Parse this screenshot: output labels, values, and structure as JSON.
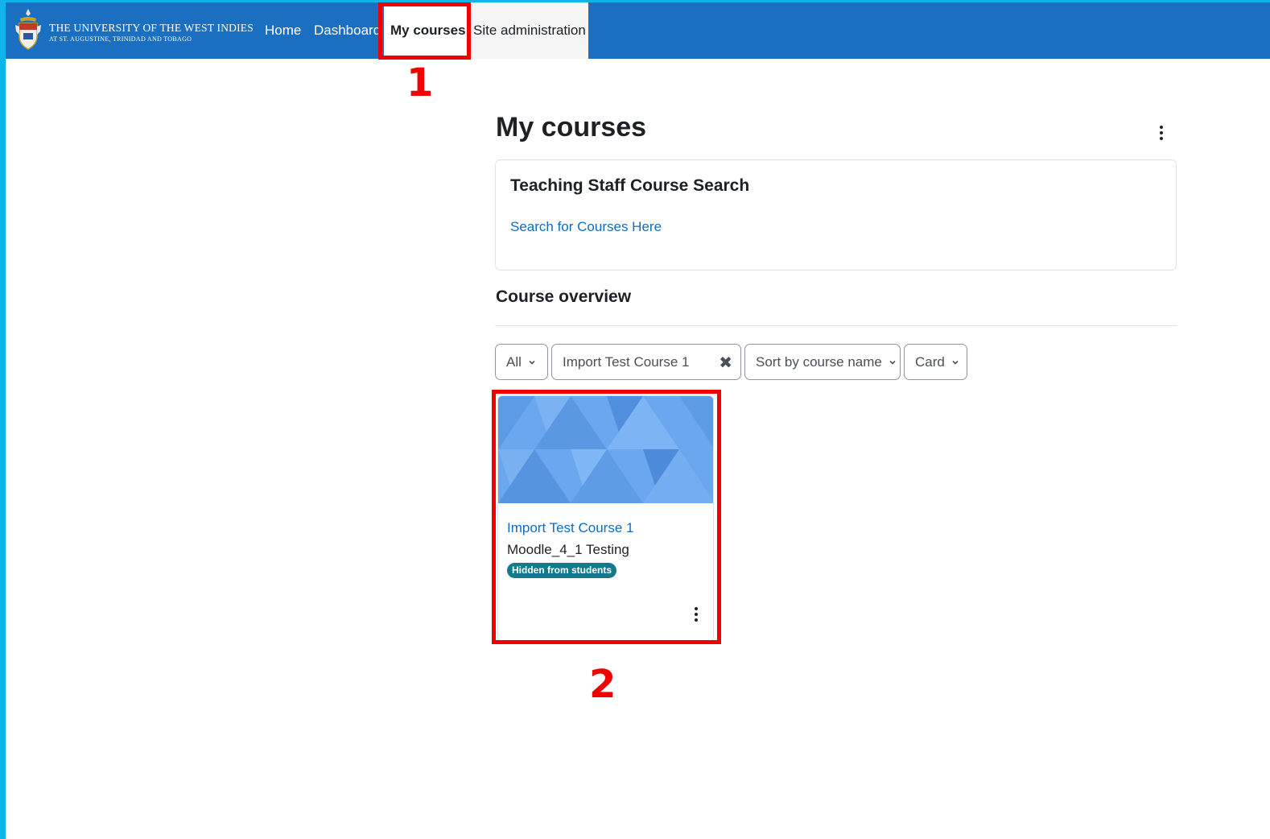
{
  "navbar": {
    "logo_line1": "THE UNIVERSITY OF THE WEST INDIES",
    "logo_line2": "AT ST. AUGUSTINE, TRINIDAD AND TOBAGO",
    "items": [
      {
        "label": "Home"
      },
      {
        "label": "Dashboard"
      },
      {
        "label": "My courses"
      },
      {
        "label": "Site administration"
      }
    ],
    "active_item": "My courses",
    "color": "#1a6fc1"
  },
  "annotations": {
    "step1": "1",
    "step2": "2",
    "color": "#f20000"
  },
  "main": {
    "title": "My courses",
    "search_block": {
      "title": "Teaching Staff Course Search",
      "link": "Search for Courses Here"
    },
    "overview": {
      "title": "Course overview",
      "filters": {
        "grouping": "All",
        "search_value": "Import Test Course 1",
        "sort": "Sort by course name",
        "display": "Card"
      },
      "courses": [
        {
          "name": "Import Test Course 1",
          "category": "Moodle_4_1 Testing",
          "badge": "Hidden from students"
        }
      ]
    }
  },
  "colors": {
    "link": "#0f6cbf",
    "badge": "#117a8b",
    "frame": "#10b4ec"
  }
}
